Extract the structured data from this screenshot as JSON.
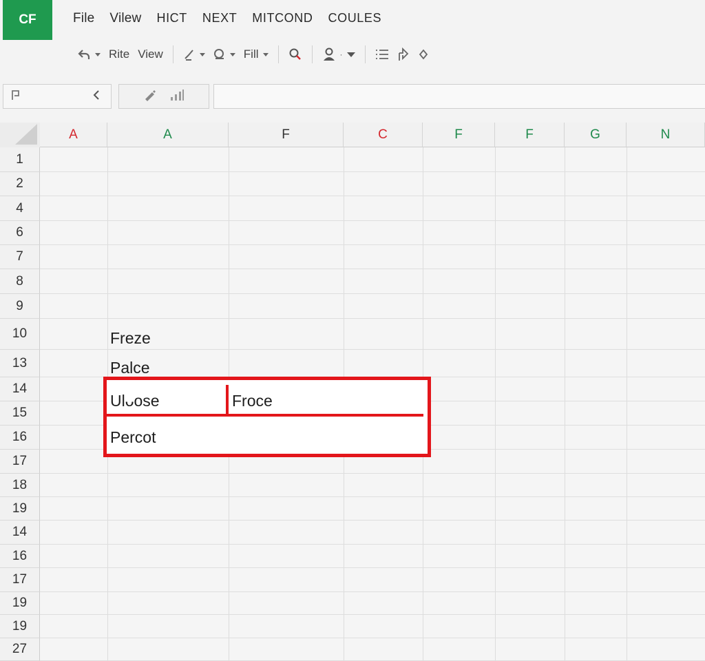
{
  "app": {
    "logo": "CF"
  },
  "menu": [
    "File",
    "Vilew",
    "HICT",
    "NEXT",
    "MITCOND",
    "COULES"
  ],
  "toolbar": {
    "rite": "Rite",
    "view": "View",
    "fill": "Fill"
  },
  "icons": {
    "undo": "undo-icon",
    "brush": "paint-brush-icon",
    "shape": "shape-icon",
    "search": "search-icon",
    "user": "user-icon",
    "list": "list-icon",
    "share": "share-icon",
    "diamond": "diamond-icon"
  },
  "columns": [
    {
      "label": "A",
      "color": "#d4282e"
    },
    {
      "label": "A",
      "color": "#1f8a4c"
    },
    {
      "label": "F",
      "color": "#333333"
    },
    {
      "label": "C",
      "color": "#d4282e"
    },
    {
      "label": "F",
      "color": "#1f8a4c"
    },
    {
      "label": "F",
      "color": "#1f8a4c"
    },
    {
      "label": "G",
      "color": "#1f8a4c"
    },
    {
      "label": "N",
      "color": "#1f8a4c"
    }
  ],
  "rows": [
    "1",
    "2",
    "4",
    "6",
    "7",
    "8",
    "9",
    "10",
    "13",
    "14",
    "15",
    "16",
    "17",
    "18",
    "19",
    "14",
    "16",
    "17",
    "19",
    "19",
    "27"
  ],
  "cells": {
    "freeze": "Freze",
    "palce": "Palce",
    "ulcose": "Ulᴗose",
    "froce": "Froce",
    "percot": "Percot"
  },
  "colors": {
    "accent": "#1f9a4f",
    "selection": "#e3161b"
  }
}
